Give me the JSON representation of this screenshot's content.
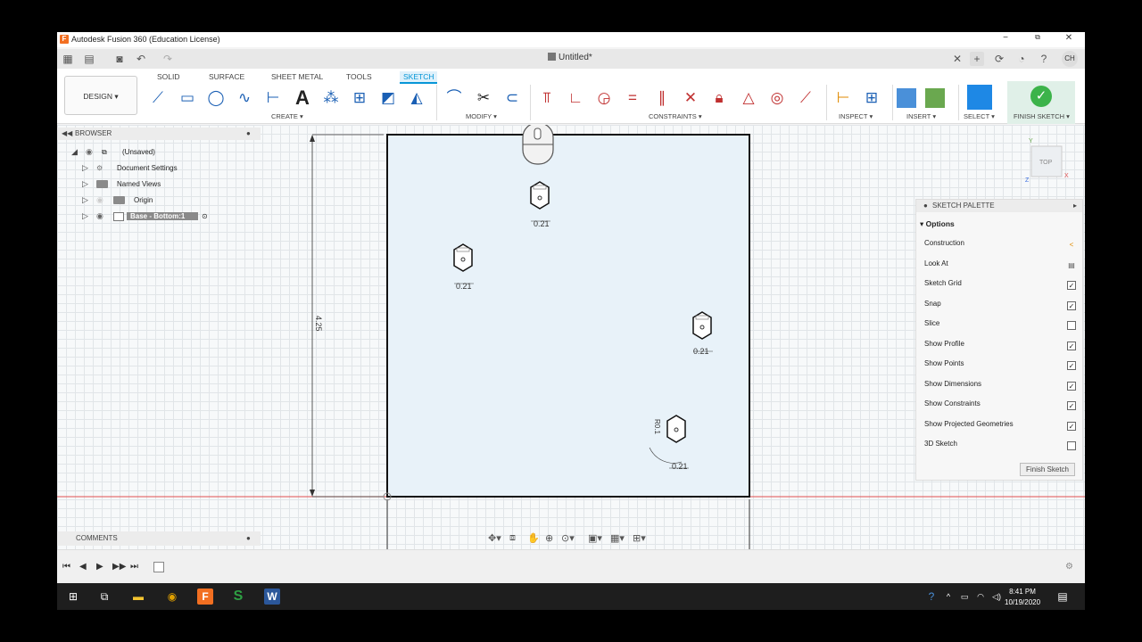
{
  "window": {
    "title": "Autodesk Fusion 360 (Education License)",
    "minimize": "−",
    "maximize": "⧉",
    "close": "✕"
  },
  "quickbar": {
    "document_title": "Untitled*",
    "user_initials": "CH"
  },
  "ribbon": {
    "workspace": "DESIGN ▾",
    "tabs": [
      "SOLID",
      "SURFACE",
      "SHEET METAL",
      "TOOLS",
      "SKETCH"
    ],
    "active_tab": "SKETCH",
    "groups": [
      "CREATE ▾",
      "MODIFY ▾",
      "CONSTRAINTS ▾",
      "INSPECT ▾",
      "INSERT ▾",
      "SELECT ▾",
      "FINISH SKETCH ▾"
    ]
  },
  "browser": {
    "header": "BROWSER",
    "items": [
      {
        "label": "(Unsaved)"
      },
      {
        "label": "Document Settings"
      },
      {
        "label": "Named Views"
      },
      {
        "label": "Origin"
      },
      {
        "label": "Base - Bottom:1"
      }
    ],
    "comments": "COMMENTS"
  },
  "sketch": {
    "dim_vertical": "4.25",
    "hole_dims": [
      "0.21",
      "0.21",
      "0.21",
      "0.21"
    ],
    "rotated_dim": "R0.1",
    "viewcube_label": "TOP",
    "axis_y": "Y",
    "axis_z": "Z",
    "axis_x": "X"
  },
  "palette": {
    "header": "SKETCH PALETTE",
    "section": "Options",
    "options": [
      {
        "label": "Construction",
        "checked": null
      },
      {
        "label": "Look At",
        "checked": null
      },
      {
        "label": "Sketch Grid",
        "checked": true
      },
      {
        "label": "Snap",
        "checked": true
      },
      {
        "label": "Slice",
        "checked": false
      },
      {
        "label": "Show Profile",
        "checked": true
      },
      {
        "label": "Show Points",
        "checked": true
      },
      {
        "label": "Show Dimensions",
        "checked": true
      },
      {
        "label": "Show Constraints",
        "checked": true
      },
      {
        "label": "Show Projected Geometries",
        "checked": true
      },
      {
        "label": "3D Sketch",
        "checked": false
      }
    ],
    "finish_button": "Finish Sketch"
  },
  "taskbar": {
    "time": "8:41 PM",
    "date": "10/19/2020"
  },
  "colors": {
    "accent": "#0696d7",
    "sketch_fill": "#e8f2f9",
    "finish_green": "#3cb34a"
  }
}
